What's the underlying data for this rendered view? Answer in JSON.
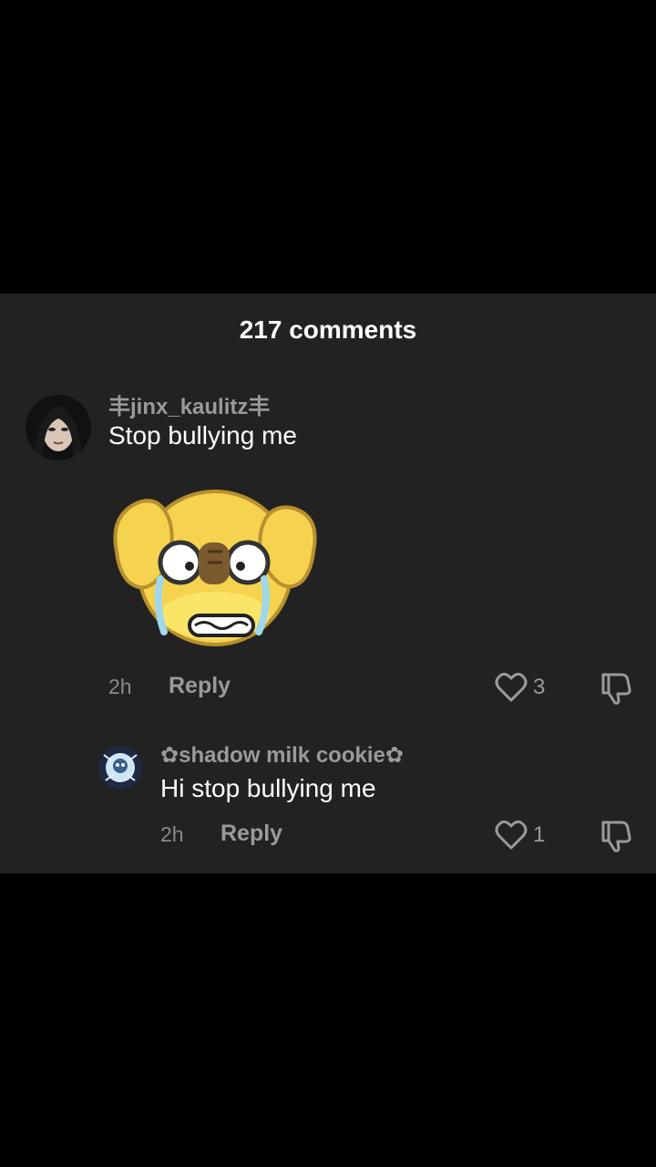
{
  "header": {
    "comment_count": "217 comments"
  },
  "comments": [
    {
      "username": "丰jinx_kaulitz丰",
      "text": "Stop bullying me",
      "time": "2h",
      "reply_label": "Reply",
      "likes": "3",
      "sticker": "crying-face-sticker"
    },
    {
      "username": "✿shadow milk cookie✿",
      "text": "Hi stop bullying me",
      "time": "2h",
      "reply_label": "Reply",
      "likes": "1"
    }
  ],
  "colors": {
    "sheet_bg": "#222222",
    "page_bg": "#000000",
    "muted": "#9a9a9a",
    "text": "#ffffff"
  }
}
